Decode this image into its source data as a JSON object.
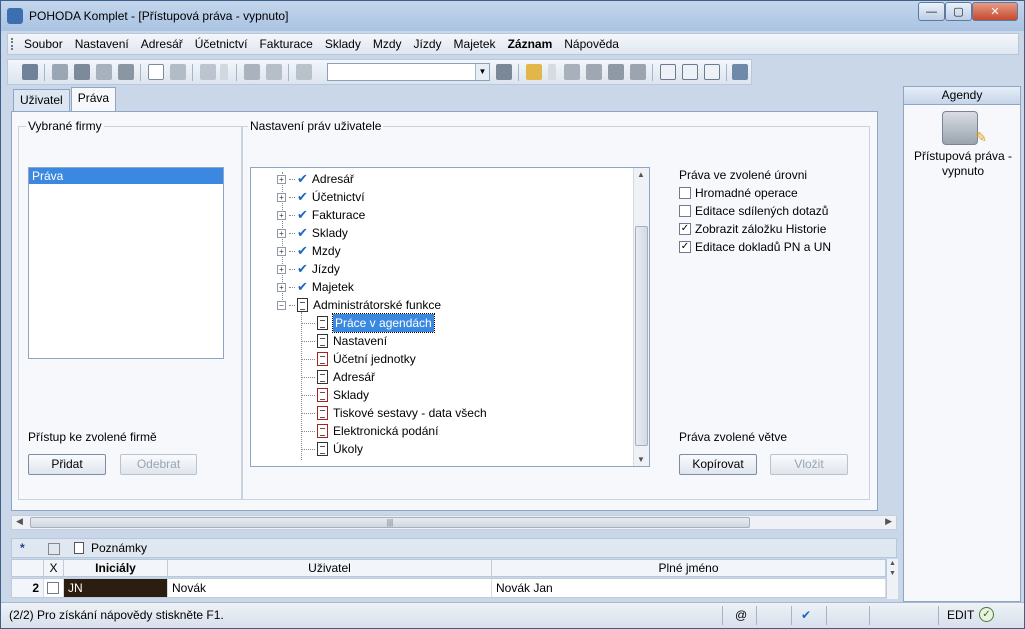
{
  "window": {
    "title": "POHODA Komplet - [Přístupová práva - vypnuto]",
    "min_glyph": "—",
    "max_glyph": "▢",
    "close_glyph": "✕"
  },
  "menu": [
    "Soubor",
    "Nastavení",
    "Adresář",
    "Účetnictví",
    "Fakturace",
    "Sklady",
    "Mzdy",
    "Jízdy",
    "Majetek",
    "Záznam",
    "Nápověda"
  ],
  "tabs": [
    {
      "label": "Uživatel",
      "active": false
    },
    {
      "label": "Práva",
      "active": true
    }
  ],
  "vybrane_firmy": {
    "title": "Vybrané firmy",
    "items": [
      {
        "label": "Práva",
        "selected": true
      }
    ],
    "access_label": "Přístup ke zvolené firmě",
    "add_button": "Přidat",
    "remove_button": "Odebrat"
  },
  "nastaveni": {
    "title": "Nastavení práv uživatele",
    "tree": [
      {
        "label": "Adresář",
        "expander": "+",
        "checked": true
      },
      {
        "label": "Účetnictví",
        "expander": "+",
        "checked": true
      },
      {
        "label": "Fakturace",
        "expander": "+",
        "checked": true
      },
      {
        "label": "Sklady",
        "expander": "+",
        "checked": true
      },
      {
        "label": "Mzdy",
        "expander": "+",
        "checked": true
      },
      {
        "label": "Jízdy",
        "expander": "+",
        "checked": true
      },
      {
        "label": "Majetek",
        "expander": "+",
        "checked": true
      },
      {
        "label": "Administrátorské funkce",
        "expander": "−",
        "checked": false
      }
    ],
    "children": [
      {
        "label": "Práce v agendách",
        "selected": true,
        "red": false
      },
      {
        "label": "Nastavení",
        "selected": false,
        "red": false
      },
      {
        "label": "Účetní jednotky",
        "selected": false,
        "red": true
      },
      {
        "label": "Adresář",
        "selected": false,
        "red": false
      },
      {
        "label": "Sklady",
        "selected": false,
        "red": true
      },
      {
        "label": "Tiskové sestavy - data všech",
        "selected": false,
        "red": true
      },
      {
        "label": "Elektronická podání",
        "selected": false,
        "red": true
      },
      {
        "label": "Úkoly",
        "selected": false,
        "red": false
      }
    ],
    "level_rights_title": "Práva ve zvolené úrovni",
    "level_rights": [
      {
        "label": "Hromadné operace",
        "checked": false
      },
      {
        "label": "Editace sdílených dotazů",
        "checked": false
      },
      {
        "label": "Zobrazit záložku Historie",
        "checked": true
      },
      {
        "label": "Editace dokladů PN a UN",
        "checked": true
      }
    ],
    "branch_rights_title": "Práva zvolené větve",
    "copy_button": "Kopírovat",
    "paste_button": "Vložit"
  },
  "bottom": {
    "star": "*",
    "notes_tab": "Poznámky",
    "columns": [
      "X",
      "Iniciály",
      "Uživatel",
      "Plné jméno"
    ],
    "rows": [
      {
        "num": "2",
        "iniciály": "JN",
        "uzivatel": "Novák",
        "plne_jmeno": "Novák Jan"
      }
    ]
  },
  "status": {
    "text": "(2/2) Pro získání nápovědy stiskněte F1.",
    "at": "@",
    "mode": "EDIT"
  },
  "agendy": {
    "title": "Agendy",
    "item_label": "Přístupová práva - vypnuto"
  }
}
